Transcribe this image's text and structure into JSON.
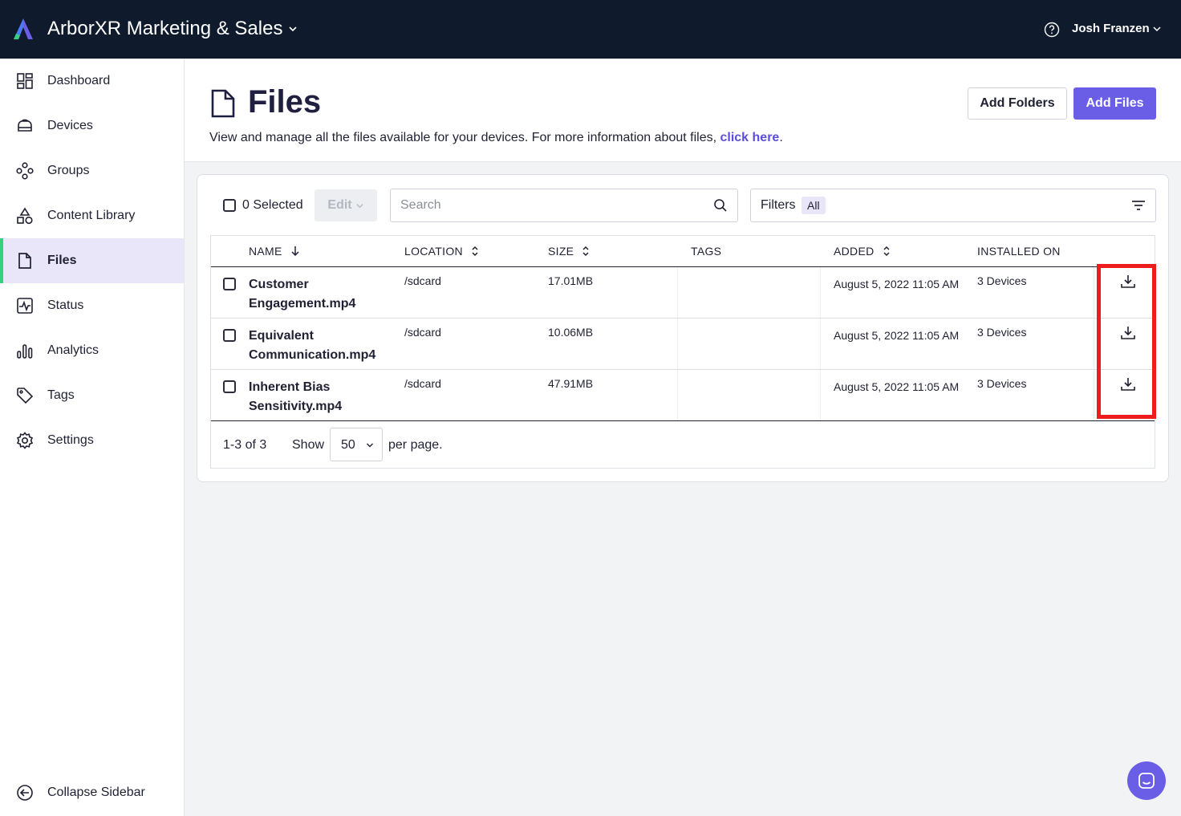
{
  "topbar": {
    "org_title": "ArborXR Marketing & Sales",
    "user_name": "Josh Franzen"
  },
  "sidebar": {
    "items": [
      {
        "label": "Dashboard",
        "icon": "dashboard-icon"
      },
      {
        "label": "Devices",
        "icon": "headset-icon"
      },
      {
        "label": "Groups",
        "icon": "groups-icon"
      },
      {
        "label": "Content Library",
        "icon": "shapes-icon"
      },
      {
        "label": "Files",
        "icon": "file-icon",
        "active": true
      },
      {
        "label": "Status",
        "icon": "pulse-icon"
      },
      {
        "label": "Analytics",
        "icon": "bar-chart-icon"
      },
      {
        "label": "Tags",
        "icon": "tag-icon"
      },
      {
        "label": "Settings",
        "icon": "gear-icon"
      }
    ],
    "collapse_label": "Collapse Sidebar"
  },
  "header": {
    "title": "Files",
    "description": "View and manage all the files available for your devices. For more information about files,",
    "link_text": "click here",
    "description_end": ".",
    "add_folders_label": "Add Folders",
    "add_files_label": "Add Files"
  },
  "toolbar": {
    "selected_label": "0 Selected",
    "edit_label": "Edit",
    "search_placeholder": "Search",
    "filters_label": "Filters",
    "filters_badge": "All"
  },
  "table": {
    "columns": [
      "NAME",
      "LOCATION",
      "SIZE",
      "TAGS",
      "ADDED",
      "INSTALLED ON"
    ],
    "rows": [
      {
        "name": "Customer Engagement.mp4",
        "location": "/sdcard",
        "size": "17.01MB",
        "tags": "",
        "added": "August 5, 2022 11:05 AM",
        "installed_on": "3 Devices"
      },
      {
        "name": "Equivalent Communication.mp4",
        "location": "/sdcard",
        "size": "10.06MB",
        "tags": "",
        "added": "August 5, 2022 11:05 AM",
        "installed_on": "3 Devices"
      },
      {
        "name": "Inherent Bias Sensitivity.mp4",
        "location": "/sdcard",
        "size": "47.91MB",
        "tags": "",
        "added": "August 5, 2022 11:05 AM",
        "installed_on": "3 Devices"
      }
    ]
  },
  "pagination": {
    "range": "1-3 of 3",
    "show_label": "Show",
    "per_page_value": "50",
    "per_page_label": "per page."
  },
  "colors": {
    "topbar": "#0f1b2d",
    "accent": "#6a5ee6",
    "active_bar": "#37d07f",
    "highlight": "#ee1c1c"
  }
}
